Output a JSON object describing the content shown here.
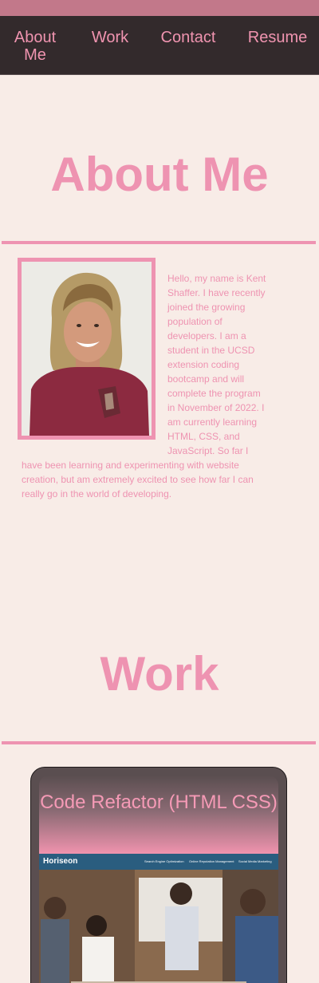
{
  "nav": {
    "items": [
      {
        "label": "About Me"
      },
      {
        "label": "Work"
      },
      {
        "label": "Contact"
      },
      {
        "label": "Resume"
      }
    ]
  },
  "about": {
    "title": "About Me",
    "bio": "Hello, my name is Kent Shaffer. I have recently joined the growing population of developers. I am a student in the UCSD extension coding bootcamp and will complete the program in November of 2022. I am currently learning HTML, CSS, and JavaScript. So far I have been learning and experimenting with website creation, but am extremely excited to see how far I can really go in the world of developing."
  },
  "work": {
    "title": "Work",
    "projects": [
      {
        "title": "Code Refactor (HTML CSS)",
        "screenshot": {
          "brand": "Horiseon",
          "links": [
            "Search Engine Optimization",
            "Online Reputation Management",
            "Social Media Marketing"
          ]
        }
      }
    ]
  },
  "colors": {
    "background": "#f8ece7",
    "accent": "#ee93b1",
    "navbar": "#332a2c",
    "top_strip": "#c2788a",
    "card": "#5a4e50"
  }
}
